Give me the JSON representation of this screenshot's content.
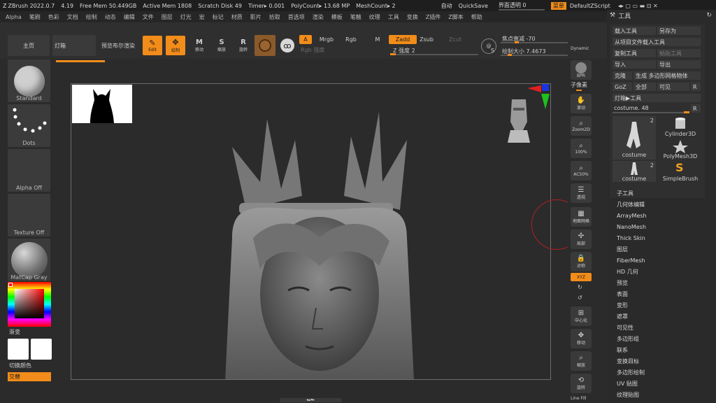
{
  "titlebar": {
    "app": "ZBrush 2022.0.7",
    "version": "4.19",
    "free_mem": "Free Mem 50.449GB",
    "active_mem": "Active Mem 1808",
    "scratch_disk": "Scratch Disk 49",
    "timer": "Timer▸ 0.001",
    "polycount": "PolyCount▸ 13.68 MP",
    "meshcount": "MeshCount▸ 2",
    "auto": "自动",
    "quicksave": "QuickSave",
    "transparency": "界面透明 0",
    "menu_btn": "菜单",
    "default_script": "DefaultZScript"
  },
  "menus": [
    "Alpha",
    "笔刷",
    "色彩",
    "文档",
    "绘制",
    "动态",
    "编辑",
    "文件",
    "图层",
    "灯光",
    "宏",
    "标记",
    "材质",
    "影片",
    "拾取",
    "首选项",
    "渲染",
    "模板",
    "笔触",
    "纹理",
    "工具",
    "变换",
    "Z插件",
    "Z脚本",
    "帮助"
  ],
  "shelf": {
    "home": "主页",
    "lightbox": "灯箱",
    "bpr": "预览布尔渲染",
    "edit": "Edit",
    "draw": "绘制",
    "move": "移动",
    "scale": "缩放",
    "rotate": "旋转",
    "a": "A",
    "mrgb": "Mrgb",
    "rgb": "Rgb",
    "m": "M",
    "rgb_intensity": "Rgb 强度",
    "zadd": "Zadd",
    "zsub": "Zsub",
    "zcut": "Zcut",
    "z_intensity": "Z 强度 2",
    "focal_shift": "焦点衰减 -70",
    "draw_size": "绘制大小 7.4673",
    "dynamic": "Dynamic",
    "s_label": "S"
  },
  "left": {
    "brush": "Standard",
    "stroke": "Dots",
    "alpha": "Alpha Off",
    "texture": "Texture Off",
    "material": "MatCap Gray",
    "gradient": "渐变",
    "switch_color": "切换颜色",
    "alternate": "交替"
  },
  "rightstrip": {
    "bpr": "BPR",
    "subpixel": "子像素",
    "scroll": "滚动",
    "zoom2d": "Zoom2D",
    "p100": "100%",
    "ac50": "AC50%",
    "persp": "透视",
    "floor": "地面网格",
    "local": "局部",
    "lsym": "对称",
    "xyz": "XYZ",
    "frame": "中心化",
    "move": "移动",
    "zoom": "缩放",
    "rotate": "旋转",
    "linefill": "Line Fill"
  },
  "tool": {
    "title": "工具",
    "load": "载入工具",
    "save_as": "另存为",
    "load_from_project": "从项目文件载入工具",
    "copy": "复制工具",
    "paste": "粘贴工具",
    "import": "导入",
    "export": "导出",
    "clone": "克隆",
    "make_polymesh": "生成 多边形网格物体",
    "goz": "GoZ",
    "all": "全部",
    "visible": "可见",
    "r": "R",
    "lightbox_tools": "灯箱▶工具",
    "costume": "costume. 48",
    "thumbs": [
      {
        "label": "costume",
        "count": "2"
      },
      {
        "label": "Cylinder3D",
        "count": ""
      },
      {
        "label": "PolyMesh3D",
        "count": ""
      },
      {
        "label": "costume",
        "count": "2"
      },
      {
        "label": "SimpleBrush",
        "count": ""
      }
    ],
    "subpalettes": [
      "子工具",
      "几何体编辑",
      "ArrayMesh",
      "NanoMesh",
      "Thick Skin",
      "图层",
      "FiberMesh",
      "HD 几何",
      "预览",
      "表面",
      "变形",
      "遮罩",
      "可见性",
      "多边形组",
      "联系",
      "变换目标",
      "多边形绘制",
      "UV 贴图",
      "纹理贴图"
    ]
  },
  "colors": {
    "accent": "#f28c1a",
    "panel": "#2b2b2b",
    "button": "#3a3a3a"
  }
}
